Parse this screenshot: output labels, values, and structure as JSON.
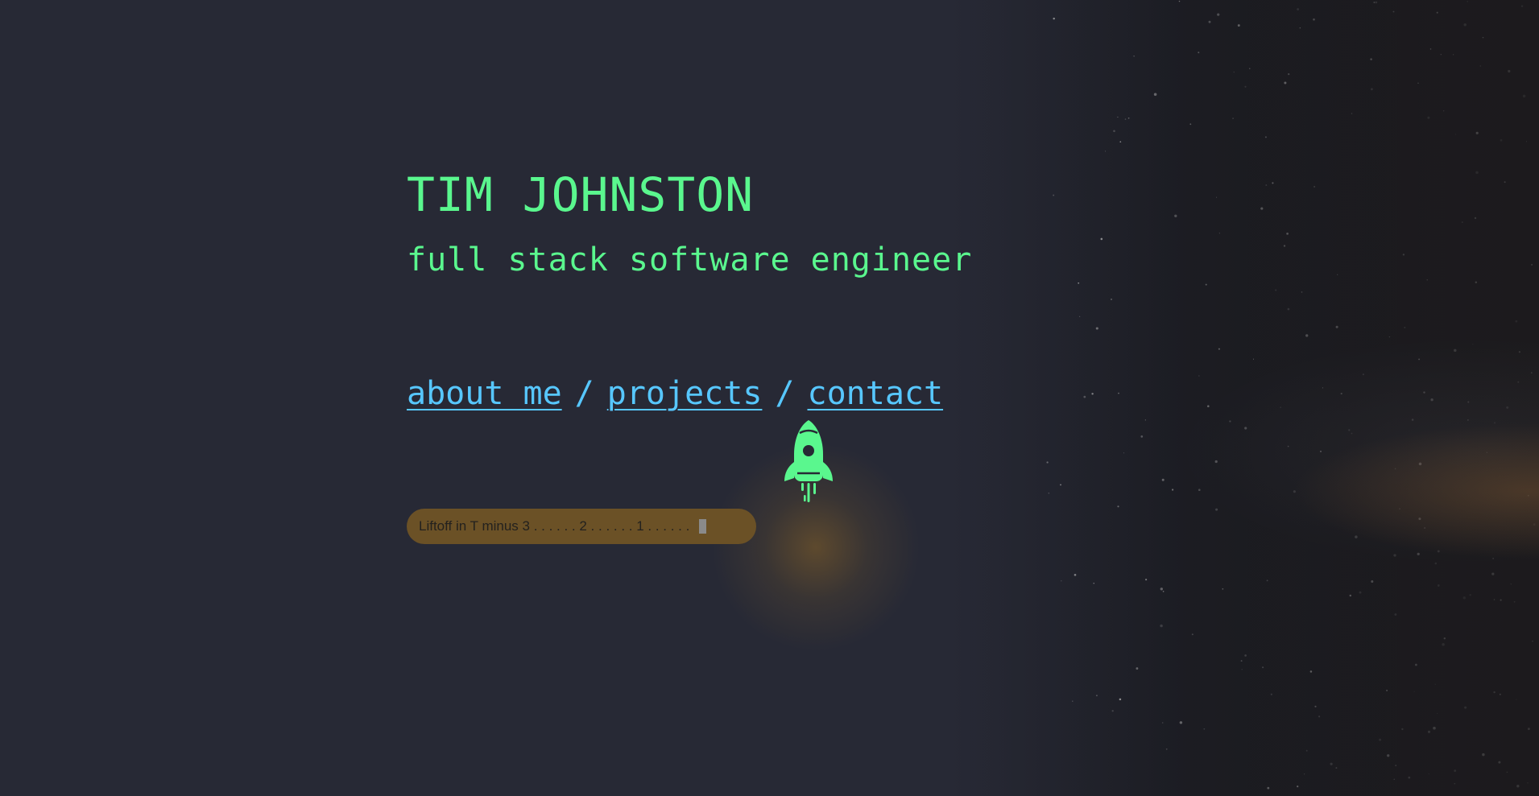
{
  "header": {
    "name": "TIM JOHNSTON",
    "subtitle": "full stack software engineer"
  },
  "nav": {
    "items": [
      {
        "label": "about me"
      },
      {
        "label": "projects"
      },
      {
        "label": "contact"
      }
    ],
    "separator": "/"
  },
  "liftoff": {
    "text": "Liftoff in T minus 3 . . . . . . 2 . . . . . . 1 . . . . . ."
  },
  "icons": {
    "rocket": "rocket-icon"
  },
  "colors": {
    "background": "#272935",
    "accent_green": "#5af78e",
    "link_blue": "#57c7ff",
    "liftoff_amber": "#6b5126"
  }
}
